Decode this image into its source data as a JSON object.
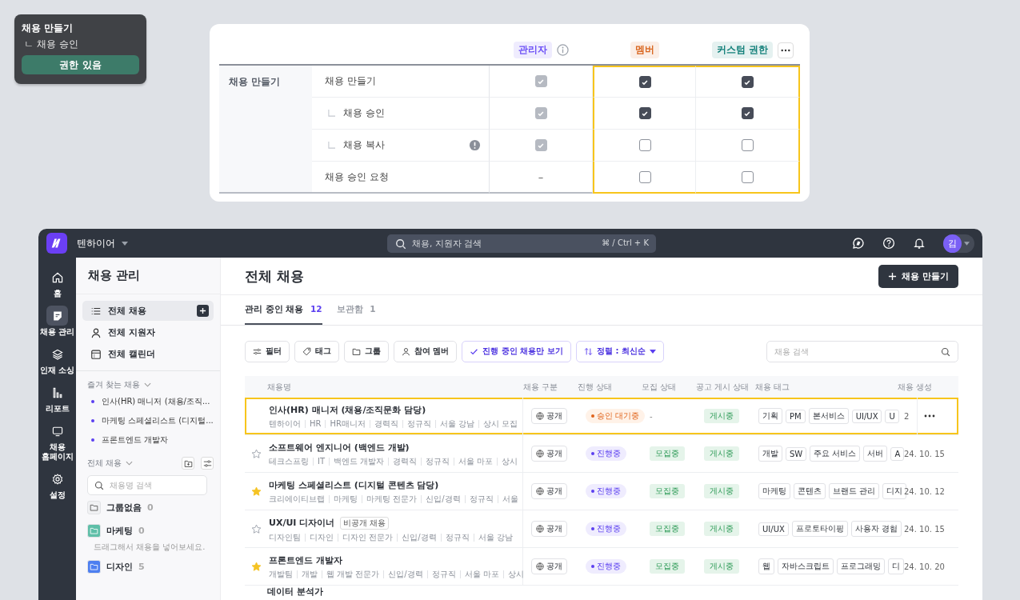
{
  "tooltip": {
    "title": "채용 만들기",
    "subtitle": "ㄴ 채용 승인",
    "button": "권한 있음"
  },
  "permissions": {
    "roles": [
      {
        "label": "관리자",
        "color": "#6b4ff6",
        "info": true,
        "more": false,
        "highlighted": false
      },
      {
        "label": "멤버",
        "color": "#d9661f",
        "info": false,
        "more": false,
        "highlighted": true
      },
      {
        "label": "커스텀 권한",
        "color": "#13807a",
        "info": false,
        "more": true,
        "highlighted": true
      }
    ],
    "category": "채용 만들기",
    "items": [
      {
        "label": "채용 만들기",
        "warning": false,
        "cells": [
          {
            "kind": "check",
            "checked": true,
            "disabled": true
          },
          {
            "kind": "check",
            "checked": true,
            "disabled": false
          },
          {
            "kind": "check",
            "checked": true,
            "disabled": false
          }
        ],
        "children": [
          {
            "label": "채용 승인",
            "warning": false,
            "cells": [
              {
                "kind": "check",
                "checked": true,
                "disabled": true
              },
              {
                "kind": "check",
                "checked": true,
                "disabled": false
              },
              {
                "kind": "check",
                "checked": true,
                "disabled": false
              }
            ]
          },
          {
            "label": "채용 복사",
            "warning": true,
            "cells": [
              {
                "kind": "check",
                "checked": true,
                "disabled": true
              },
              {
                "kind": "check",
                "checked": false,
                "disabled": false
              },
              {
                "kind": "check",
                "checked": false,
                "disabled": false
              }
            ]
          }
        ]
      },
      {
        "label": "채용 승인 요청",
        "warning": false,
        "cells": [
          {
            "kind": "dash",
            "text": "–"
          },
          {
            "kind": "check",
            "checked": false,
            "disabled": false
          },
          {
            "kind": "check",
            "checked": false,
            "disabled": false
          }
        ]
      }
    ]
  },
  "app": {
    "workspace": "텐하이어",
    "search": {
      "placeholder": "채용, 지원자 검색",
      "shortcut": "⌘ / Ctrl + K"
    },
    "avatar": "김",
    "rail": [
      {
        "label": "홈",
        "kind": "home",
        "selected": false
      },
      {
        "label": "채용 관리",
        "kind": "note",
        "selected": true
      },
      {
        "label": "인재 소싱",
        "kind": "layers",
        "selected": false
      },
      {
        "label": "리포트",
        "kind": "report",
        "selected": false
      },
      {
        "label": "채용 홈페이지",
        "kind": "monitor",
        "selected": false
      },
      {
        "label": "설정",
        "kind": "gear",
        "selected": false
      }
    ],
    "sidebar": {
      "title": "채용 관리",
      "nav": [
        {
          "label": "전체 채용",
          "kind": "list",
          "selected": true,
          "add": true
        },
        {
          "label": "전체 지원자",
          "kind": "person",
          "selected": false,
          "add": false
        },
        {
          "label": "전체 캘린더",
          "kind": "calendar",
          "selected": false,
          "add": false
        }
      ],
      "favorites_title": "즐겨 찾는 채용",
      "favorites": [
        "인사(HR) 매니저 (채용/조직...",
        "마케팅 스페셜리스트 (디지털...",
        "프론트엔드 개발자"
      ],
      "all_title": "전체 채용",
      "search_placeholder": "채용명 검색",
      "groups": [
        {
          "name": "그룹없음",
          "count": "0",
          "color": "#f0f1f3"
        },
        {
          "name": "마케팅",
          "count": "0",
          "color": "#5fbfa8",
          "hint": "드래그해서 채용을 넣어보세요."
        },
        {
          "name": "디자인",
          "count": "5",
          "color": "#4d7ff0"
        }
      ]
    },
    "main": {
      "title": "전체 채용",
      "create_button": "채용 만들기",
      "tabs": [
        {
          "label": "관리 중인 채용",
          "count": "12",
          "selected": true
        },
        {
          "label": "보관함",
          "count": "1",
          "selected": false
        }
      ],
      "toolbar": [
        {
          "label": "필터",
          "kind": "filter",
          "selected": false
        },
        {
          "label": "태그",
          "kind": "tag",
          "selected": false
        },
        {
          "label": "그룹",
          "kind": "folder",
          "selected": false
        },
        {
          "label": "참여 멤버",
          "kind": "person",
          "selected": false
        },
        {
          "label": "진행 중인 채용만 보기",
          "kind": "check",
          "selected": true
        },
        {
          "label": "정렬 : 최신순",
          "kind": "sort",
          "selected": true
        }
      ],
      "search_placeholder": "채용 검색",
      "table": {
        "columns": [
          "채용명",
          "채용 구분",
          "진행 상태",
          "모집 상태",
          "공고 게시 상태",
          "채용 태그",
          "채용 생성"
        ],
        "rows": [
          {
            "title": "인사(HR) 매니저 (채용/조직문화 담당)",
            "highlighted": true,
            "meta": [
              "텐하이어",
              "HR",
              "HR매니저",
              "경력직",
              "정규직",
              "서울 강남",
              "상시 모집"
            ],
            "type": "공개",
            "progress": {
              "label": "승인 대기중",
              "kind": "pending"
            },
            "recruit": {
              "label": "-",
              "kind": "none"
            },
            "post": "게시중",
            "tags": [
              "기획",
              "PM",
              "본서비스",
              "UI/UX",
              "U"
            ],
            "date": "2"
          },
          {
            "title": "소프트웨어 엔지니어 (백엔드 개발)",
            "highlighted": false,
            "starred": false,
            "meta": [
              "테크스프링",
              "IT",
              "백엔드 개발자",
              "경력직",
              "정규직",
              "서울 마포",
              "상시"
            ],
            "type": "공개",
            "progress": {
              "label": "진행중",
              "kind": "active"
            },
            "recruit": {
              "label": "모집중",
              "kind": "open"
            },
            "post": "게시중",
            "tags": [
              "개발",
              "SW",
              "주요 서비스",
              "서버",
              "A"
            ],
            "date": "24. 10. 15"
          },
          {
            "title": "마케팅 스페셜리스트 (디지털 콘텐츠 담당)",
            "highlighted": false,
            "starred": true,
            "meta": [
              "크리에이티브랩",
              "마케팅",
              "마케팅 전문가",
              "신입/경력",
              "정규직",
              "서울"
            ],
            "type": "공개",
            "progress": {
              "label": "진행중",
              "kind": "active"
            },
            "recruit": {
              "label": "모집중",
              "kind": "open"
            },
            "post": "게시중",
            "tags": [
              "마케팅",
              "콘텐츠",
              "브랜드 관리",
              "디지"
            ],
            "date": "24. 10. 12"
          },
          {
            "title": "UX/UI 디자이너",
            "badge": "비공개 채용",
            "highlighted": false,
            "starred": false,
            "meta": [
              "디자인팀",
              "디자인",
              "디자인 전문가",
              "신입/경력",
              "정규직",
              "서울 강남"
            ],
            "type": "공개",
            "progress": {
              "label": "진행중",
              "kind": "active"
            },
            "recruit": {
              "label": "모집중",
              "kind": "open"
            },
            "post": "게시중",
            "tags": [
              "UI/UX",
              "프로토타이핑",
              "사용자 경험"
            ],
            "date": "24. 10. 15"
          },
          {
            "title": "프론트엔드 개발자",
            "highlighted": false,
            "starred": true,
            "meta": [
              "개발팀",
              "개발",
              "웹 개발 전문가",
              "신입/경력",
              "정규직",
              "서울 마포",
              "상시"
            ],
            "type": "공개",
            "progress": {
              "label": "진행중",
              "kind": "active"
            },
            "recruit": {
              "label": "모집중",
              "kind": "open"
            },
            "post": "게시중",
            "tags": [
              "웹",
              "자바스크립트",
              "프로그래밍",
              "디"
            ],
            "date": "24. 10. 20"
          },
          {
            "title": "데이터 분석가",
            "partial": true
          }
        ]
      }
    }
  }
}
